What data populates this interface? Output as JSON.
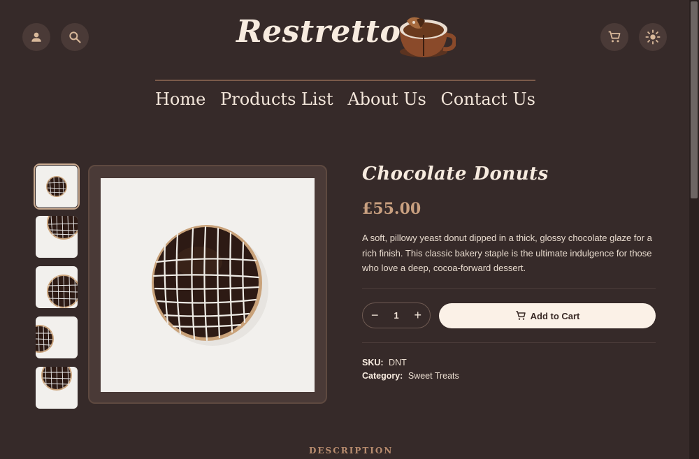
{
  "header": {
    "logo": "Restretto",
    "icons": [
      "user-icon",
      "search-icon",
      "cart-icon",
      "theme-toggle-icon"
    ]
  },
  "nav": {
    "items": [
      {
        "label": "Home"
      },
      {
        "label": "Products List"
      },
      {
        "label": "About Us"
      },
      {
        "label": "Contact Us"
      }
    ]
  },
  "product": {
    "title": "Chocolate Donuts",
    "price": "£55.00",
    "description": "A soft, pillowy yeast donut dipped in a thick, glossy chocolate glaze for a rich finish. This classic bakery staple is the ultimate indulgence for those who love a deep, cocoa-forward dessert.",
    "quantity": "1",
    "add_to_cart": "Add to Cart",
    "sku_label": "SKU:",
    "sku": "DNT",
    "category_label": "Category:",
    "category": "Sweet Treats"
  },
  "tabs": {
    "description": "DESCRIPTION"
  },
  "colors": {
    "background": "#362a29",
    "accent": "#c9a080",
    "button": "#fbf1e7"
  }
}
